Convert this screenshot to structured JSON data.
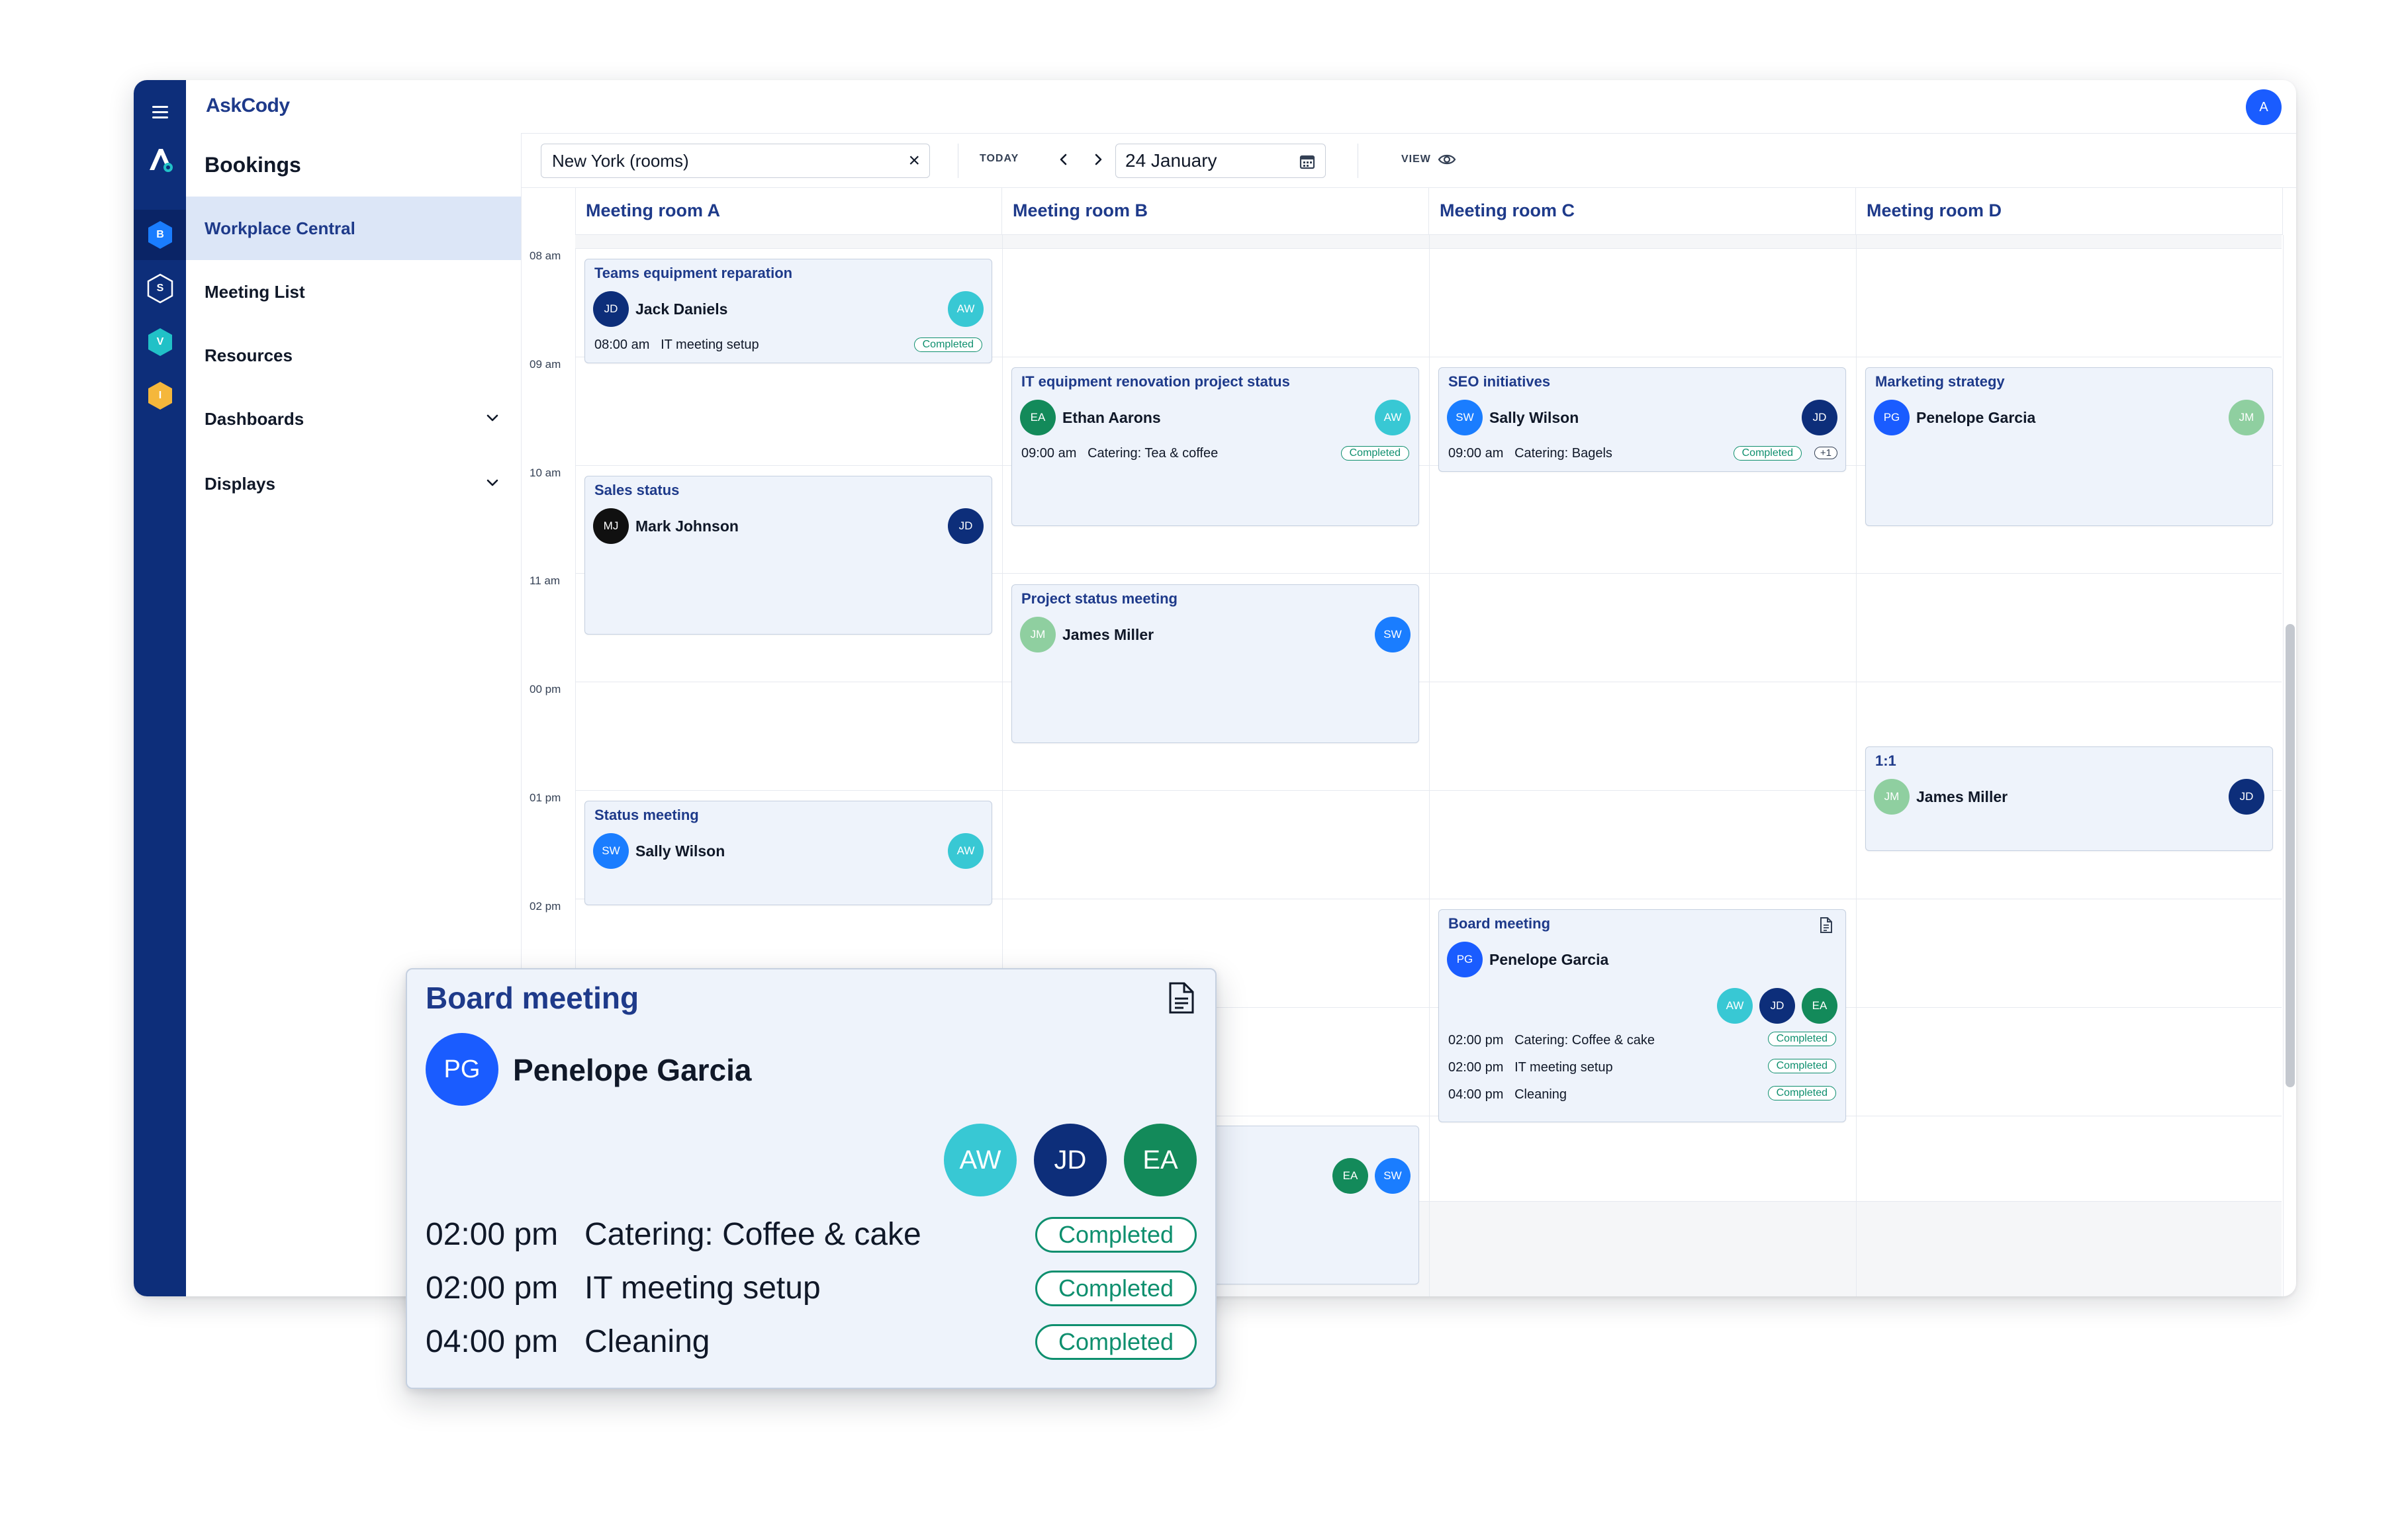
{
  "app": {
    "brand": "AskCody",
    "user_initial": "A"
  },
  "rail": {
    "apps": [
      {
        "letter": "B",
        "color": "#1a7dff"
      },
      {
        "letter": "S",
        "color": "#0d2e7a"
      },
      {
        "letter": "V",
        "color": "#21c1c7"
      },
      {
        "letter": "I",
        "color": "#f5b73b"
      }
    ]
  },
  "nav": {
    "title": "Bookings",
    "items": [
      {
        "label": "Workplace Central"
      },
      {
        "label": "Meeting List"
      },
      {
        "label": "Resources"
      },
      {
        "label": "Dashboards"
      },
      {
        "label": "Displays"
      }
    ]
  },
  "toolbar": {
    "location": "New York (rooms)",
    "today": "TODAY",
    "date": "24 January",
    "view": "VIEW"
  },
  "times": [
    "08 am",
    "09 am",
    "10 am",
    "11 am",
    "00 pm",
    "01 pm",
    "02 pm"
  ],
  "rooms": [
    "Meeting room A",
    "Meeting room B",
    "Meeting room C",
    "Meeting room D"
  ],
  "bookings": {
    "teams": {
      "title": "Teams equipment reparation",
      "organizer": "Jack Daniels",
      "org_initials": "JD",
      "attendee": "AW",
      "time": "08:00 am",
      "service": "IT meeting setup",
      "status": "Completed"
    },
    "sales": {
      "title": "Sales status",
      "organizer": "Mark Johnson",
      "org_initials": "MJ",
      "attendee": "JD"
    },
    "status": {
      "title": "Status meeting",
      "organizer": "Sally Wilson",
      "org_initials": "SW",
      "attendee": "AW"
    },
    "it": {
      "title": "IT equipment renovation project status",
      "organizer": "Ethan Aarons",
      "org_initials": "EA",
      "attendee": "AW",
      "time": "09:00 am",
      "service": "Catering: Tea & coffee",
      "status": "Completed"
    },
    "project": {
      "title": "Project status meeting",
      "organizer": "James Miller",
      "org_initials": "JM",
      "attendee": "SW"
    },
    "b_lower": {
      "attendees": [
        "EA",
        "SW"
      ]
    },
    "seo": {
      "title": "SEO initiatives",
      "organizer": "Sally Wilson",
      "org_initials": "SW",
      "attendee": "JD",
      "time": "09:00 am",
      "service": "Catering: Bagels",
      "status": "Completed",
      "more": "+1"
    },
    "board": {
      "title": "Board meeting",
      "organizer": "Penelope Garcia",
      "org_initials": "PG",
      "attendees": [
        "AW",
        "JD",
        "EA"
      ],
      "services": [
        {
          "time": "02:00 pm",
          "label": "Catering: Coffee & cake",
          "status": "Completed"
        },
        {
          "time": "02:00 pm",
          "label": "IT meeting setup",
          "status": "Completed"
        },
        {
          "time": "04:00 pm",
          "label": "Cleaning",
          "status": "Completed"
        }
      ]
    },
    "marketing": {
      "title": "Marketing strategy",
      "organizer": "Penelope Garcia",
      "org_initials": "PG",
      "attendee": "JM"
    },
    "oneone": {
      "title": "1:1",
      "organizer": "James Miller",
      "org_initials": "JM",
      "attendee": "JD"
    }
  },
  "popup": {
    "title": "Board meeting",
    "organizer": "Penelope Garcia",
    "org_initials": "PG",
    "attendees": [
      "AW",
      "JD",
      "EA"
    ],
    "services": [
      {
        "time": "02:00 pm",
        "label": "Catering: Coffee & cake",
        "status": "Completed"
      },
      {
        "time": "02:00 pm",
        "label": "IT meeting setup",
        "status": "Completed"
      },
      {
        "time": "04:00 pm",
        "label": "Cleaning",
        "status": "Completed"
      }
    ]
  }
}
